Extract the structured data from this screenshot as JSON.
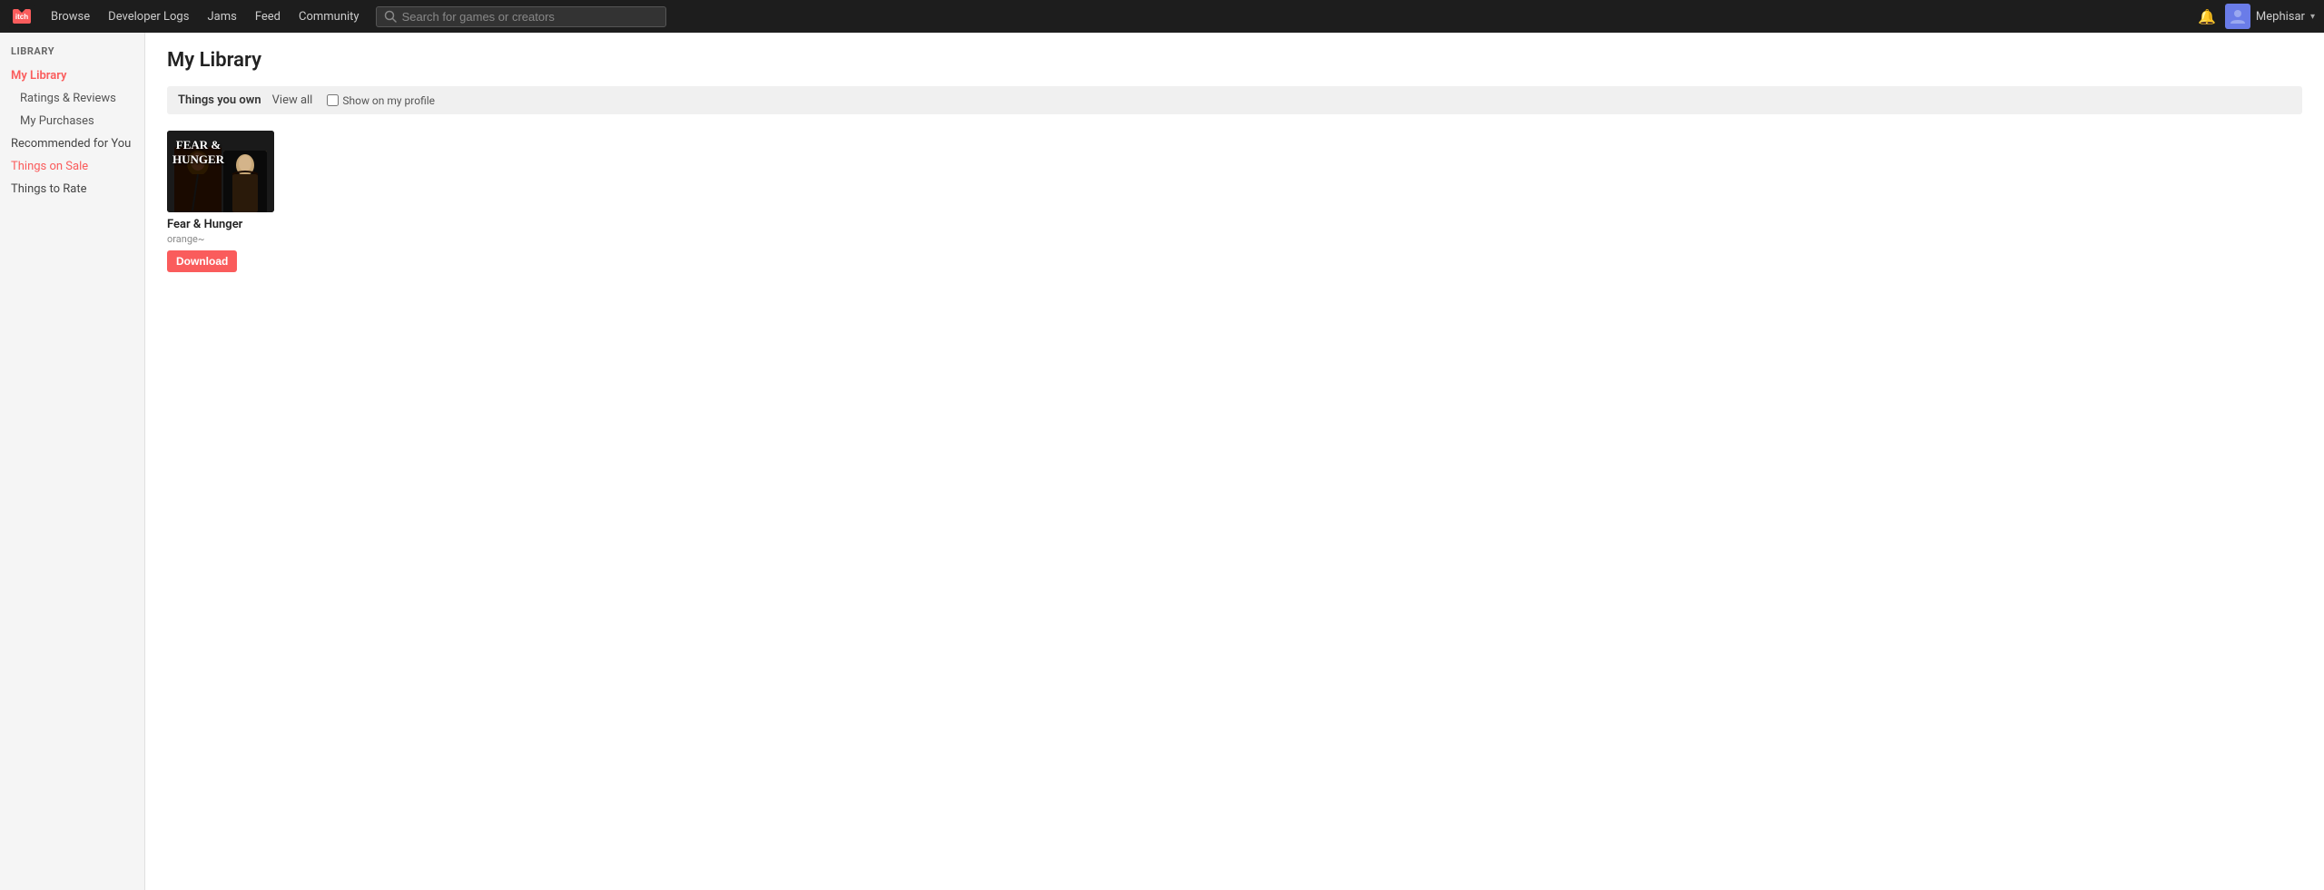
{
  "topnav": {
    "logo_alt": "itch.io logo",
    "links": [
      {
        "label": "Browse",
        "id": "browse"
      },
      {
        "label": "Developer Logs",
        "id": "devlogs"
      },
      {
        "label": "Jams",
        "id": "jams"
      },
      {
        "label": "Feed",
        "id": "feed"
      },
      {
        "label": "Community",
        "id": "community"
      }
    ],
    "search_placeholder": "Search for games or creators",
    "username": "Mephisar",
    "chevron": "▾"
  },
  "sidebar": {
    "section_label": "LIBRARY",
    "items": [
      {
        "label": "My Library",
        "id": "my-library",
        "active": true,
        "sub": false,
        "red": true
      },
      {
        "label": "Ratings & Reviews",
        "id": "ratings-reviews",
        "active": false,
        "sub": true,
        "red": false
      },
      {
        "label": "My Purchases",
        "id": "my-purchases",
        "active": false,
        "sub": true,
        "red": false
      },
      {
        "label": "Recommended for You",
        "id": "recommended",
        "active": false,
        "sub": false,
        "red": false
      },
      {
        "label": "Things on Sale",
        "id": "things-on-sale",
        "active": false,
        "sub": false,
        "red": true
      },
      {
        "label": "Things to Rate",
        "id": "things-to-rate",
        "active": false,
        "sub": false,
        "red": false
      }
    ]
  },
  "main": {
    "page_title": "My Library",
    "section_bar": {
      "title": "Things you own",
      "view_all": "View all",
      "show_profile_label": "Show on my profile"
    },
    "games": [
      {
        "id": "fear-and-hunger",
        "name": "Fear & Hunger",
        "creator": "orange~",
        "download_label": "Download"
      }
    ]
  }
}
